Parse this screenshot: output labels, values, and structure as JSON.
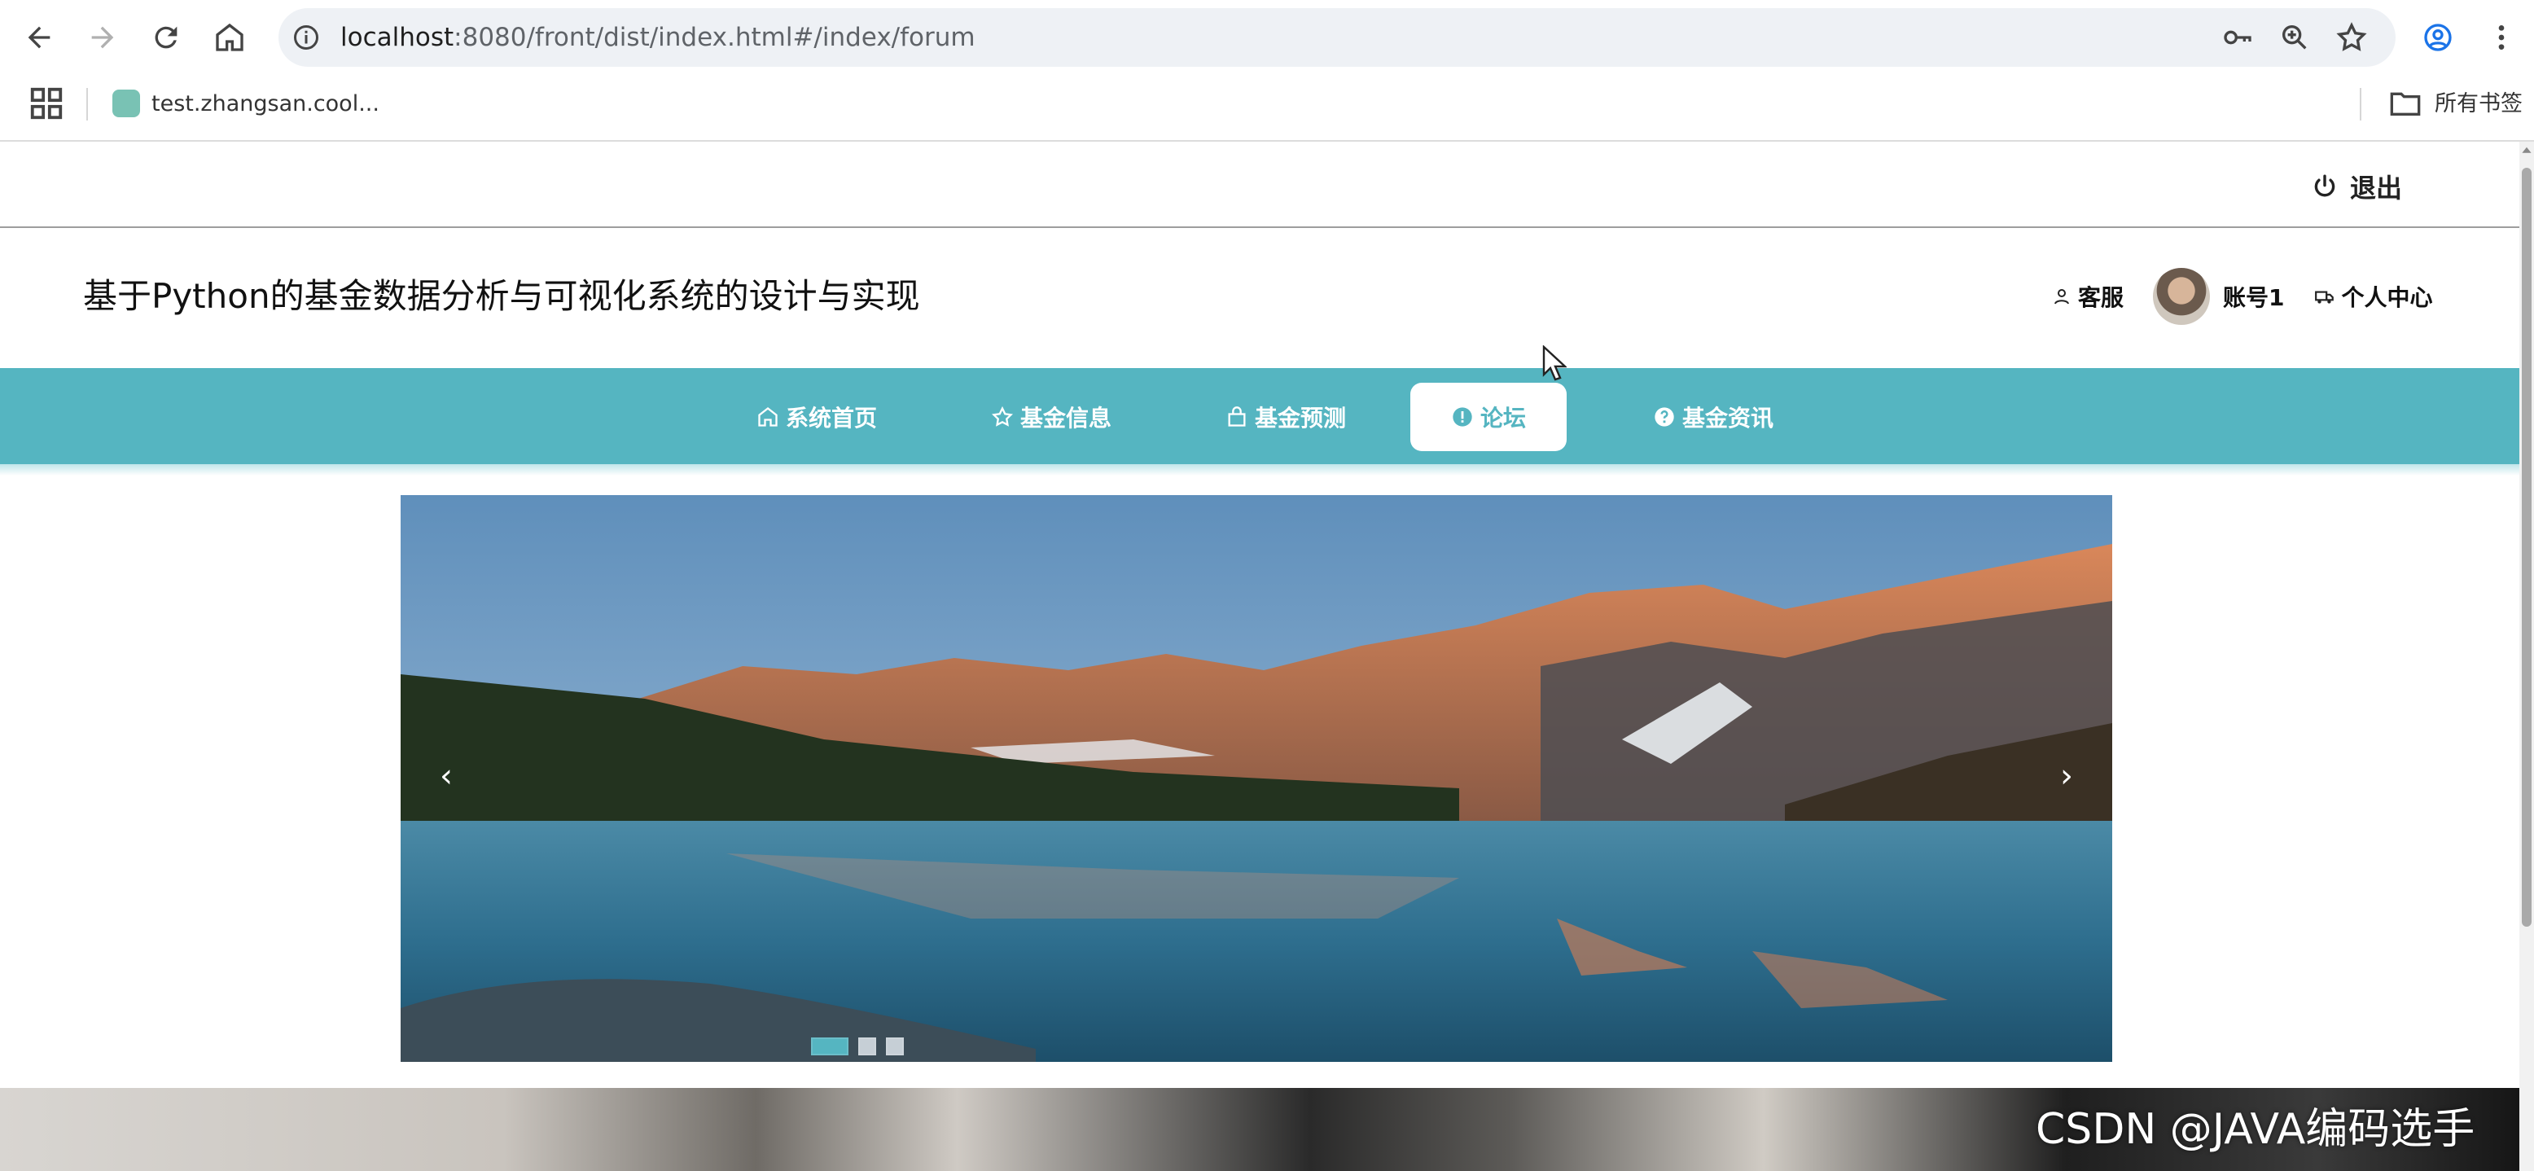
{
  "browser": {
    "url_host": "localhost",
    "url_rest": ":8080/front/dist/index.html#/index/forum",
    "bookmark_label": "test.zhangsan.cool...",
    "all_bookmarks_label": "所有书签"
  },
  "top": {
    "logout_label": "退出"
  },
  "header": {
    "title": "基于Python的基金数据分析与可视化系统的设计与实现",
    "service_label": "客服",
    "account_label": "账号1",
    "personal_center_label": "个人中心"
  },
  "nav": {
    "items": [
      {
        "label": "系统首页",
        "icon": "home-icon"
      },
      {
        "label": "基金信息",
        "icon": "star-icon"
      },
      {
        "label": "基金预测",
        "icon": "bag-icon"
      },
      {
        "label": "论坛",
        "icon": "info-icon",
        "active": true
      },
      {
        "label": "基金资讯",
        "icon": "question-icon"
      }
    ],
    "accent_color": "#55b5c1"
  },
  "carousel": {
    "prev_label": "‹",
    "next_label": "›",
    "slide_count": 3,
    "active_slide": 1
  },
  "watermark": "CSDN @JAVA编码选手"
}
